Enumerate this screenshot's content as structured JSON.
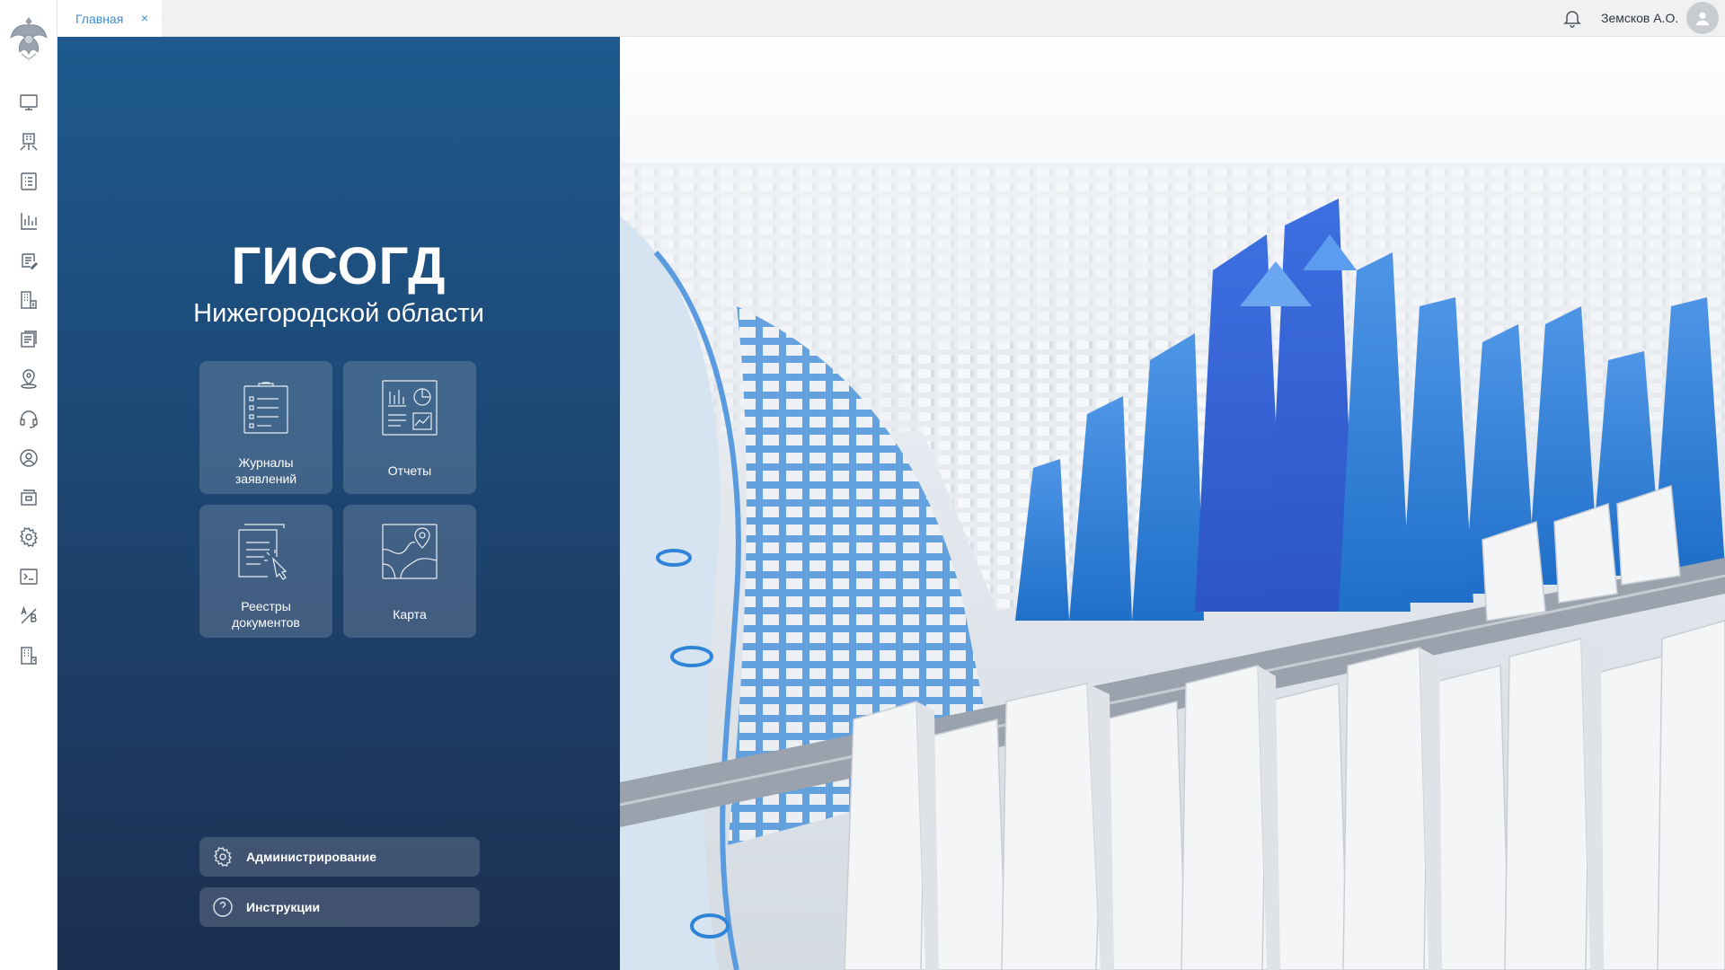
{
  "tabs": [
    {
      "label": "Главная",
      "close": "×"
    }
  ],
  "user": {
    "name": "Земсков А.О."
  },
  "rail": {
    "items": [
      {
        "name": "monitor-icon"
      },
      {
        "name": "buildings-network-icon"
      },
      {
        "name": "checklist-icon"
      },
      {
        "name": "bar-chart-icon"
      },
      {
        "name": "document-edit-icon"
      },
      {
        "name": "building-document-icon"
      },
      {
        "name": "register-icon"
      },
      {
        "name": "map-pin-icon"
      },
      {
        "name": "headset-icon"
      },
      {
        "name": "user-circle-icon"
      },
      {
        "name": "archive-icon"
      },
      {
        "name": "gear-icon"
      },
      {
        "name": "terminal-icon"
      },
      {
        "name": "ab-test-icon"
      },
      {
        "name": "building-list-icon"
      }
    ]
  },
  "panel": {
    "title": "ГИСОГД",
    "subtitle": "Нижегородской области",
    "tiles": [
      {
        "label_line1": "Журналы",
        "label_line2": "заявлений",
        "icon": "clipboard-list-icon"
      },
      {
        "label_line1": "Отчеты",
        "label_line2": "",
        "icon": "report-charts-icon"
      },
      {
        "label_line1": "Реестры",
        "label_line2": "документов",
        "icon": "document-registry-icon"
      },
      {
        "label_line1": "Карта",
        "label_line2": "",
        "icon": "map-icon"
      }
    ],
    "actions": [
      {
        "label": "Администрирование",
        "icon": "gear-icon"
      },
      {
        "label": "Инструкции",
        "icon": "help-circle-icon"
      }
    ]
  },
  "colors": {
    "panel_top": "#1e5a8e",
    "panel_bottom": "#1b2f50",
    "accent": "#3b8ed6",
    "tab_text": "#3b8ed6"
  }
}
